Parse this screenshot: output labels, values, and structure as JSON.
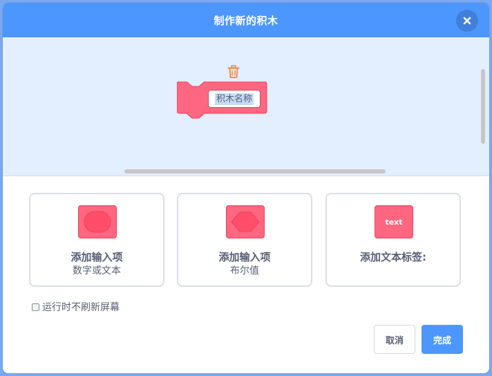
{
  "header": {
    "title": "制作新的积木"
  },
  "block": {
    "name_placeholder": "积木名称",
    "color": "#ff6680"
  },
  "options": [
    {
      "title": "添加输入项",
      "subtitle": "数字或文本",
      "icon": "round-input-shape-icon"
    },
    {
      "title": "添加输入项",
      "subtitle": "布尔值",
      "icon": "hexagon-boolean-shape-icon"
    },
    {
      "title": "添加文本标签:",
      "subtitle": "",
      "icon": "text-label-icon",
      "icon_text": "text"
    }
  ],
  "checkbox": {
    "label": "运行时不刷新屏幕",
    "checked": false
  },
  "footer": {
    "cancel_label": "取消",
    "ok_label": "完成"
  },
  "colors": {
    "header": "#4c97ff",
    "workspace": "#e3eefe",
    "block": "#ff6680",
    "text": "#575e75",
    "trash": "#f2843f"
  }
}
